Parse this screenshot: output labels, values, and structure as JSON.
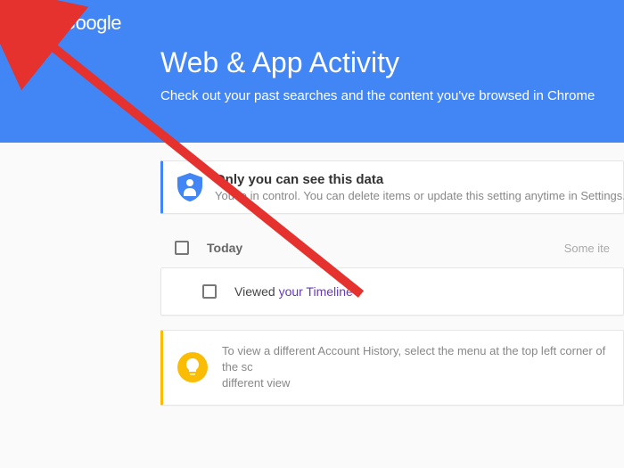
{
  "header": {
    "logo": "Google",
    "title": "Web & App Activity",
    "subtitle": "Check out your past searches and the content you've browsed in Chrome"
  },
  "privacy": {
    "title": "Only you can see this data",
    "subtitle": "You're in control. You can delete items or update this setting anytime in Settings."
  },
  "today": {
    "label": "Today",
    "someItems": "Some ite"
  },
  "item": {
    "prefix": "Viewed ",
    "link": "your Timeline"
  },
  "tip": {
    "text": "To view a different Account History, select the menu at the top left corner of the sc",
    "text2": "different view"
  }
}
